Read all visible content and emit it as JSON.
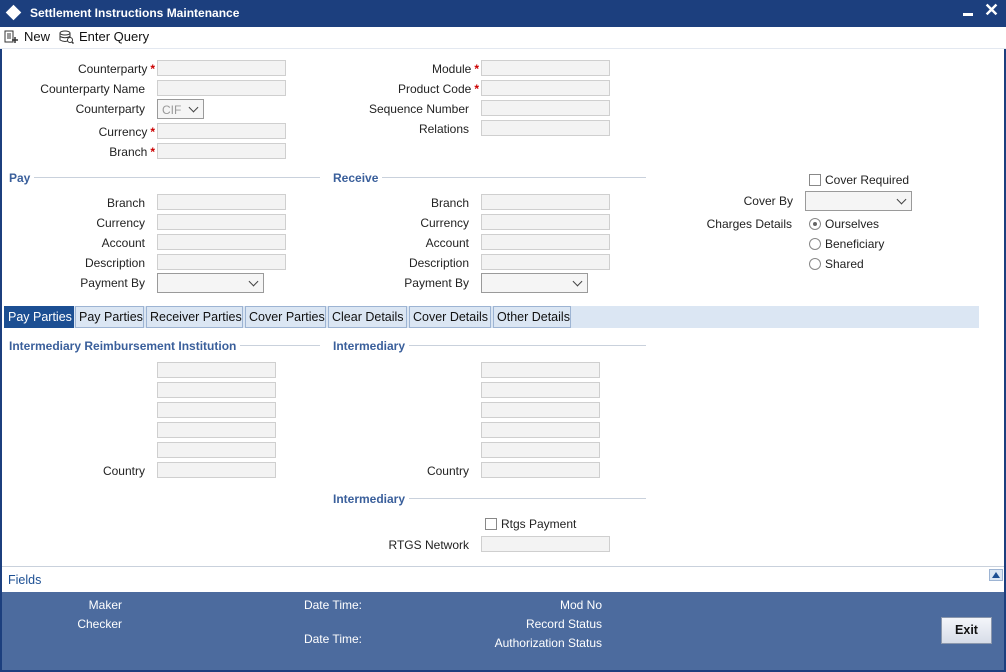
{
  "window": {
    "title": "Settlement Instructions Maintenance"
  },
  "toolbar": {
    "new_label": "New",
    "enter_query_label": "Enter Query"
  },
  "header": {
    "counterparty_label": "Counterparty",
    "counterparty_name_label": "Counterparty Name",
    "counterparty_type_label": "Counterparty",
    "counterparty_type_value": "CIF",
    "currency_label": "Currency",
    "branch_label": "Branch",
    "module_label": "Module",
    "product_code_label": "Product Code",
    "sequence_number_label": "Sequence Number",
    "relations_label": "Relations",
    "required_mark": "*"
  },
  "pay": {
    "title": "Pay",
    "branch_label": "Branch",
    "currency_label": "Currency",
    "account_label": "Account",
    "description_label": "Description",
    "payment_by_label": "Payment By"
  },
  "receive": {
    "title": "Receive",
    "branch_label": "Branch",
    "currency_label": "Currency",
    "account_label": "Account",
    "description_label": "Description",
    "payment_by_label": "Payment By"
  },
  "cover": {
    "cover_required_label": "Cover Required",
    "cover_by_label": "Cover By",
    "charges_details_label": "Charges Details",
    "charges_options": [
      "Ourselves",
      "Beneficiary",
      "Shared"
    ],
    "charges_selected": "Ourselves"
  },
  "tabs": [
    {
      "label": "Pay Parties",
      "active": true
    },
    {
      "label": "Pay Parties",
      "active": false
    },
    {
      "label": "Receiver Parties",
      "active": false
    },
    {
      "label": "Cover Parties",
      "active": false
    },
    {
      "label": "Clear Details",
      "active": false
    },
    {
      "label": "Cover Details",
      "active": false
    },
    {
      "label": "Other Details",
      "active": false
    }
  ],
  "tab_content": {
    "intermediary_reimbursement_title": "Intermediary Reimbursement Institution",
    "intermediary_title": "Intermediary",
    "country_label": "Country",
    "intermediary2_title": "Intermediary",
    "rtgs_payment_label": "Rtgs Payment",
    "rtgs_network_label": "RTGS Network"
  },
  "fields_bar": {
    "label": "Fields"
  },
  "footer": {
    "maker_label": "Maker",
    "checker_label": "Checker",
    "date_time_label_1": "Date Time:",
    "date_time_label_2": "Date Time:",
    "mod_no_label": "Mod No",
    "record_status_label": "Record Status",
    "authorization_status_label": "Authorization Status",
    "exit_label": "Exit"
  }
}
